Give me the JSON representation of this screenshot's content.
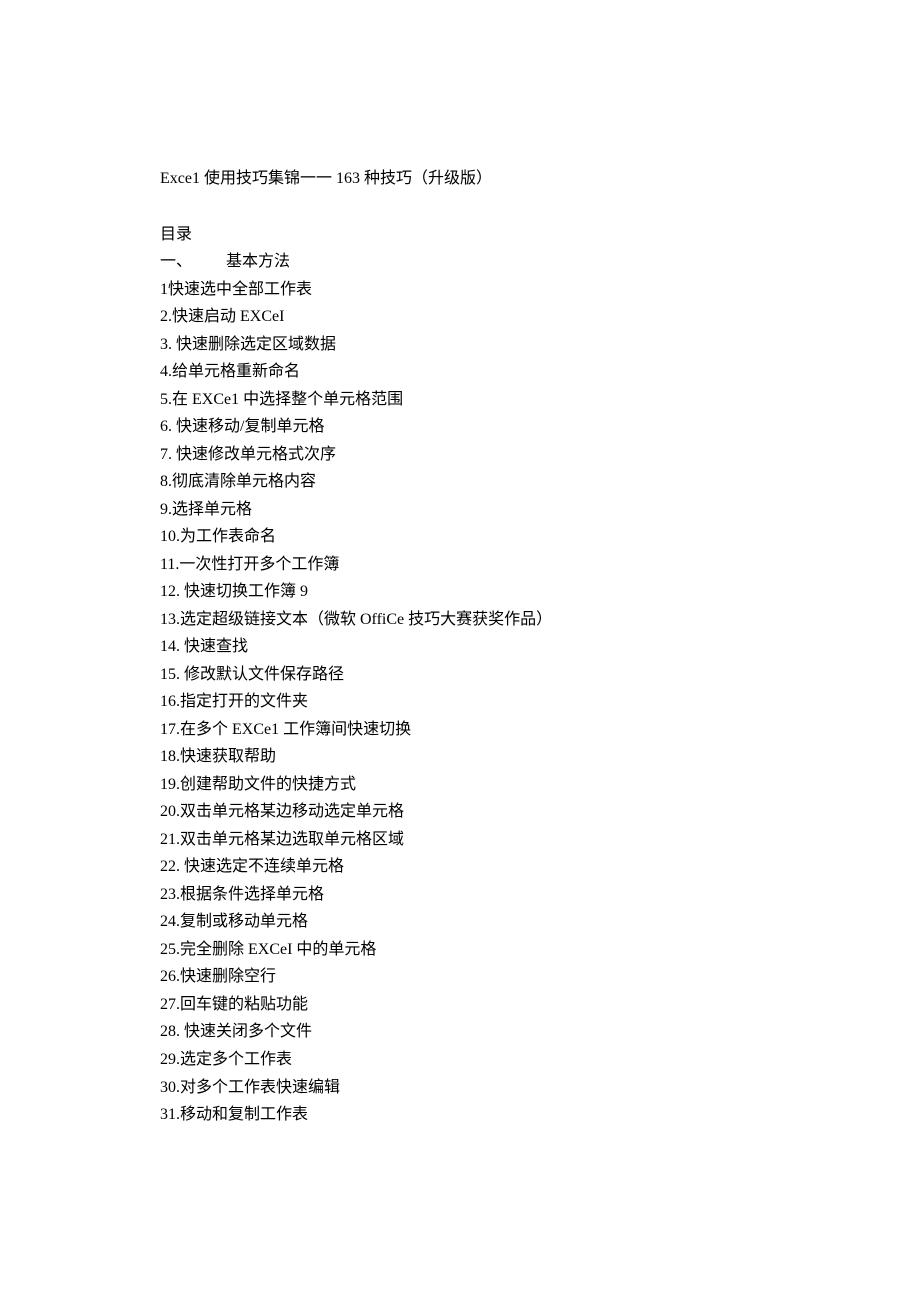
{
  "title": "Exce1 使用技巧集锦一一 163 种技巧（升级版）",
  "toc_heading": "目录",
  "section": {
    "num": "一、",
    "label": "基本方法"
  },
  "items": [
    {
      "num": "1",
      "text": "快速选中全部工作表"
    },
    {
      "num": "2",
      "text": " .快速启动 EXCeI"
    },
    {
      "num": "3",
      "text": " . 快速删除选定区域数据"
    },
    {
      "num": "4",
      "text": " .给单元格重新命名"
    },
    {
      "num": "5",
      "text": " .在 EXCe1 中选择整个单元格范围"
    },
    {
      "num": "6",
      "text": " . 快速移动/复制单元格"
    },
    {
      "num": "7",
      "text": " . 快速修改单元格式次序"
    },
    {
      "num": "8",
      "text": " .彻底清除单元格内容"
    },
    {
      "num": "9",
      "text": " .选择单元格"
    },
    {
      "num": "10",
      "text": " .为工作表命名"
    },
    {
      "num": "11",
      "text": " .一次性打开多个工作簿"
    },
    {
      "num": "12",
      "text": " . 快速切换工作簿 9"
    },
    {
      "num": "13",
      "text": " .选定超级链接文本（微软 OffiCe 技巧大赛获奖作品）"
    },
    {
      "num": "14",
      "text": " . 快速查找"
    },
    {
      "num": "15",
      "text": " . 修改默认文件保存路径"
    },
    {
      "num": "16",
      "text": " .指定打开的文件夹"
    },
    {
      "num": "17",
      "text": " .在多个 EXCe1 工作簿间快速切换"
    },
    {
      "num": "18",
      "text": " .快速获取帮助"
    },
    {
      "num": "19",
      "text": " .创建帮助文件的快捷方式"
    },
    {
      "num": "20",
      "text": " .双击单元格某边移动选定单元格"
    },
    {
      "num": "21",
      "text": " .双击单元格某边选取单元格区域"
    },
    {
      "num": "22",
      "text": " . 快速选定不连续单元格"
    },
    {
      "num": "23",
      "text": " .根据条件选择单元格"
    },
    {
      "num": "24",
      "text": " .复制或移动单元格"
    },
    {
      "num": "25",
      "text": " .完全删除 EXCeI 中的单元格"
    },
    {
      "num": "26",
      "text": " .快速删除空行"
    },
    {
      "num": "27",
      "text": " .回车键的粘贴功能"
    },
    {
      "num": "28",
      "text": " . 快速关闭多个文件"
    },
    {
      "num": "29",
      "text": " .选定多个工作表"
    },
    {
      "num": "30",
      "text": " .对多个工作表快速编辑"
    },
    {
      "num": "31",
      "text": " .移动和复制工作表"
    }
  ]
}
